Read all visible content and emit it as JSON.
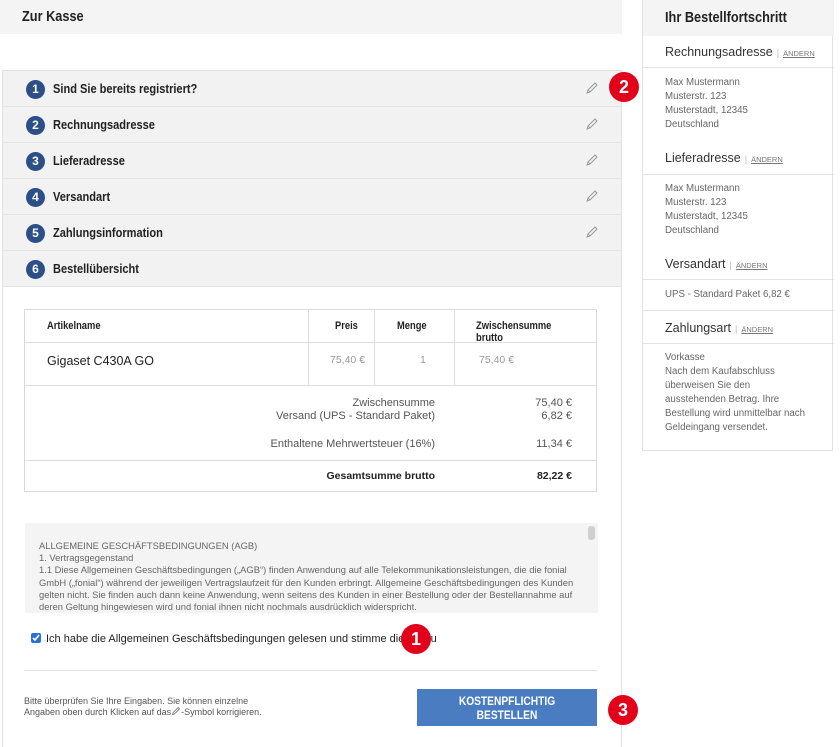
{
  "main": {
    "title": "Zur Kasse",
    "steps": [
      {
        "num": "1",
        "label": "Sind Sie bereits registriert?",
        "editable": true
      },
      {
        "num": "2",
        "label": "Rechnungsadresse",
        "editable": true
      },
      {
        "num": "3",
        "label": "Lieferadresse",
        "editable": true
      },
      {
        "num": "4",
        "label": "Versandart",
        "editable": true
      },
      {
        "num": "5",
        "label": "Zahlungsinformation",
        "editable": true
      },
      {
        "num": "6",
        "label": "Bestellübersicht",
        "editable": false
      }
    ],
    "table": {
      "headers": {
        "article": "Artikelname",
        "price": "Preis",
        "qty": "Menge",
        "subtotal": "Zwischensumme brutto"
      },
      "row": {
        "article": "Gigaset C430A GO",
        "price": "75,40 €",
        "qty": "1",
        "subtotal": "75,40 €"
      },
      "summary": {
        "subtotal_label": "Zwischensumme",
        "subtotal_value": "75,40 €",
        "shipping_label": "Versand (UPS - Standard Paket)",
        "shipping_value": "6,82 €",
        "vat_label": "Enthaltene Mehrwertsteuer (16%)",
        "vat_value": "11,34 €",
        "total_label": "Gesamtsumme brutto",
        "total_value": "82,22 €"
      }
    },
    "terms": {
      "heading": "ALLGEMEINE GESCHÄFTSBEDINGUNGEN (AGB)",
      "section": "1. Vertragsgegenstand",
      "text": "1.1 Diese Allgemeinen Geschäftsbedingungen („AGB“) finden Anwendung auf alle Telekommunikationsleistungen, die die fonial GmbH („fonial“) während der jeweiligen Vertragslaufzeit für den Kunden erbringt. Allgemeine Geschäftsbedingungen des Kunden gelten nicht. Sie finden auch dann keine Anwendung, wenn seitens des Kunden in einer Bestellung oder der Bestellannahme auf deren Geltung hingewiesen wird und fonial ihnen nicht nochmals ausdrücklich widerspricht."
    },
    "agree_label": "Ich habe die Allgemeinen Geschäftsbedingungen gelesen und stimme diesen zu",
    "agree_checked": true,
    "hint_line1": "Bitte überprüfen Sie Ihre Eingaben. Sie können einzelne",
    "hint_line2_a": "Angaben oben durch Klicken auf das",
    "hint_line2_b": "-Symbol korrigieren.",
    "order_button": "KOSTENPFLICHTIG BESTELLEN"
  },
  "badges": {
    "b1": "1",
    "b2": "2",
    "b3": "3"
  },
  "sidebar": {
    "title": "Ihr Bestellfortschritt",
    "edit_label": "ÄNDERN",
    "billing": {
      "title": "Rechnungsadresse",
      "lines": [
        "Max Mustermann",
        "Musterstr. 123",
        "Musterstadt, 12345",
        "Deutschland"
      ]
    },
    "shipping": {
      "title": "Lieferadresse",
      "lines": [
        "Max Mustermann",
        "Musterstr. 123",
        "Musterstadt, 12345",
        "Deutschland"
      ]
    },
    "method": {
      "title": "Versandart",
      "text": "UPS - Standard Paket 6,82 €"
    },
    "payment": {
      "title": "Zahlungsart",
      "lines": [
        "Vorkasse",
        "Nach dem Kaufabschluss",
        "überweisen Sie den",
        "ausstehenden Betrag. Ihre",
        "Bestellung wird unmittelbar nach",
        "Geldeingang versendet."
      ]
    }
  },
  "colors": {
    "step_circle": "#2b4f86",
    "badge": "#e3001b",
    "button": "#4a7cc2"
  },
  "icons": {
    "edit": "pencil-icon"
  }
}
